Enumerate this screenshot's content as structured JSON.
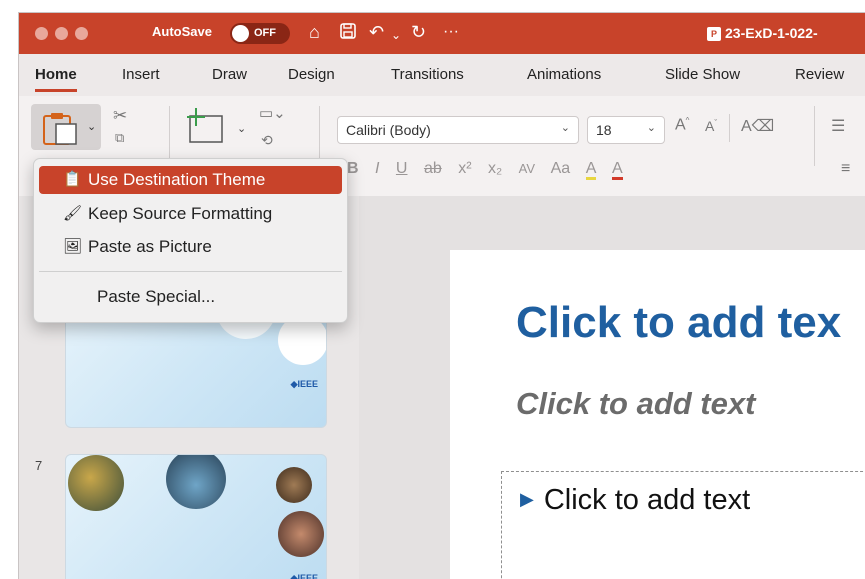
{
  "titlebar": {
    "autosave_label": "AutoSave",
    "autosave_state": "OFF",
    "document_title": "23-ExD-1-022-",
    "more_label": "···"
  },
  "tabs": [
    {
      "label": "Home"
    },
    {
      "label": "Insert"
    },
    {
      "label": "Draw"
    },
    {
      "label": "Design"
    },
    {
      "label": "Transitions"
    },
    {
      "label": "Animations"
    },
    {
      "label": "Slide Show"
    },
    {
      "label": "Review"
    }
  ],
  "ribbon": {
    "font_name": "Calibri (Body)",
    "font_size": "18",
    "format_buttons": [
      "B",
      "I",
      "U",
      "ab",
      "x²",
      "x₂",
      "AV",
      "Aa",
      "A",
      "A"
    ]
  },
  "paste_menu": {
    "items": [
      {
        "label": "Use Destination Theme",
        "icon": "clipboard-theme-icon"
      },
      {
        "label": "Keep Source Formatting",
        "icon": "clipboard-brush-icon"
      },
      {
        "label": "Paste as Picture",
        "icon": "clipboard-picture-icon"
      }
    ],
    "special_label": "Paste Special..."
  },
  "thumbnails": {
    "slide_number": "7",
    "logo_text": "◆IEEE"
  },
  "slide": {
    "title": "Click to add tex",
    "subtitle": "Click to add text",
    "bullet": "Click to add text"
  }
}
